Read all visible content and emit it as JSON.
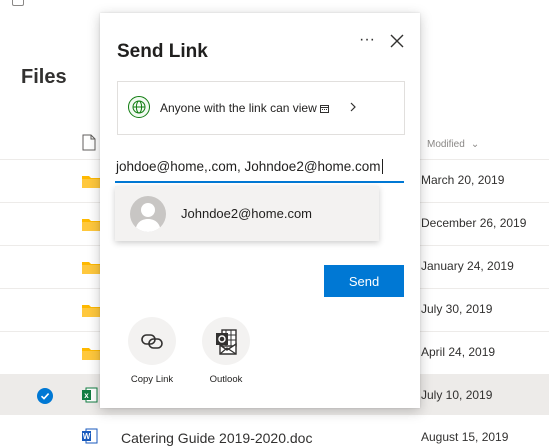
{
  "page": {
    "files_title": "Files"
  },
  "table": {
    "modified_header": "Modified",
    "rows": [
      {
        "date": "March 20, 2019"
      },
      {
        "date": "December 26, 2019"
      },
      {
        "date": "January 24, 2019"
      },
      {
        "date": "July 30, 2019"
      },
      {
        "date": "April 24, 2019"
      },
      {
        "date": "July 10, 2019"
      },
      {
        "name": "Catering Guide 2019-2020.doc",
        "date": "August 15, 2019"
      }
    ]
  },
  "dialog": {
    "title": "Send Link",
    "more_label": "···",
    "permission": "Anyone with the link can view",
    "to_value": "johdoe@home,.com, Johndoe2@home.com",
    "suggestion": "Johndoe2@home.com",
    "send_label": "Send",
    "options": [
      {
        "label": "Copy Link",
        "icon": "link-icon"
      },
      {
        "label": "Outlook",
        "icon": "outlook-icon"
      }
    ]
  },
  "colors": {
    "accent": "#0078d4",
    "globe": "#107c10",
    "selected_row": "#edebe9"
  }
}
